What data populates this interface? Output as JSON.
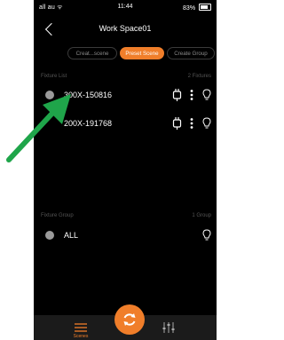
{
  "status_bar": {
    "carrier": "all au ᯤ",
    "time": "11:44",
    "battery": "83%"
  },
  "nav": {
    "title": "Work Space01"
  },
  "segments": [
    {
      "label": "Creat...scene",
      "active": false
    },
    {
      "label": "Preset Scene",
      "active": true
    },
    {
      "label": "Create Group",
      "active": false
    }
  ],
  "fixture_list": {
    "label": "Fixture List",
    "count": "2 Fixtures",
    "items": [
      {
        "name": "300X-150816"
      },
      {
        "name": "200X-191768"
      }
    ]
  },
  "fixture_group": {
    "label": "Fixture Group",
    "count": "1 Group",
    "items": [
      {
        "name": "ALL"
      }
    ]
  },
  "bottom_tabs": {
    "scenes_label": "Scenes"
  },
  "colors": {
    "accent": "#f07e2a",
    "arrow": "#1fa54a",
    "background": "#000000"
  }
}
